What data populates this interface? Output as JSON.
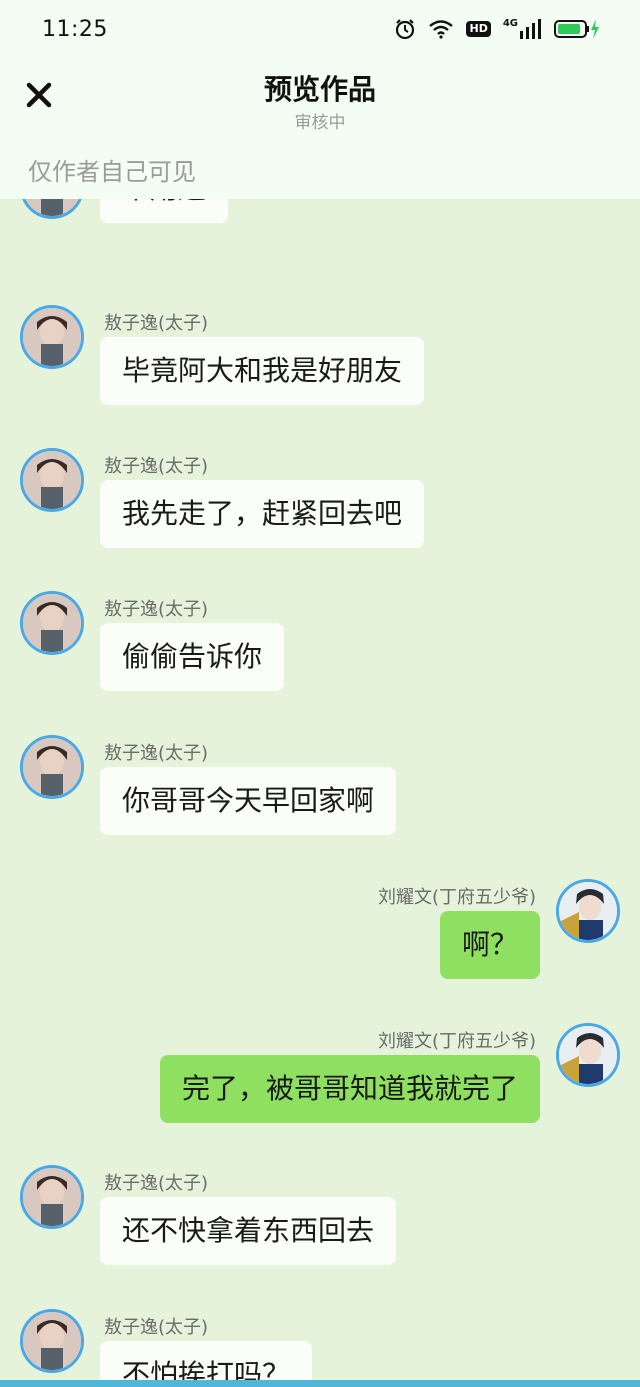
{
  "status_bar": {
    "time": "11:25",
    "icons": [
      "alarm-icon",
      "wifi-icon",
      "hd-icon",
      "signal-4g-icon",
      "battery-charging-icon"
    ],
    "hd_label": "HD",
    "network_label": "4G"
  },
  "header": {
    "close_icon": "close-icon",
    "title": "预览作品",
    "subtitle": "审核中",
    "visibility_note": "仅作者自己可见"
  },
  "messages": [
    {
      "side": "left",
      "sender": "",
      "text": "不用还"
    },
    {
      "side": "left",
      "sender": "敖子逸(太子)",
      "text": "毕竟阿大和我是好朋友"
    },
    {
      "side": "left",
      "sender": "敖子逸(太子)",
      "text": "我先走了，赶紧回去吧"
    },
    {
      "side": "left",
      "sender": "敖子逸(太子)",
      "text": "偷偷告诉你"
    },
    {
      "side": "left",
      "sender": "敖子逸(太子)",
      "text": "你哥哥今天早回家啊"
    },
    {
      "side": "right",
      "sender": "刘耀文(丁府五少爷)",
      "text": "啊？"
    },
    {
      "side": "right",
      "sender": "刘耀文(丁府五少爷)",
      "text": "完了，被哥哥知道我就完了"
    },
    {
      "side": "left",
      "sender": "敖子逸(太子)",
      "text": "还不快拿着东西回去"
    },
    {
      "side": "left",
      "sender": "敖子逸(太子)",
      "text": "不怕挨打吗？"
    }
  ],
  "colors": {
    "chat_background": "#e4f3da",
    "header_background": "#f4fdf3",
    "left_bubble": "#fbfdf8",
    "right_bubble": "#8fe061",
    "avatar_border": "#4aa8e6"
  }
}
